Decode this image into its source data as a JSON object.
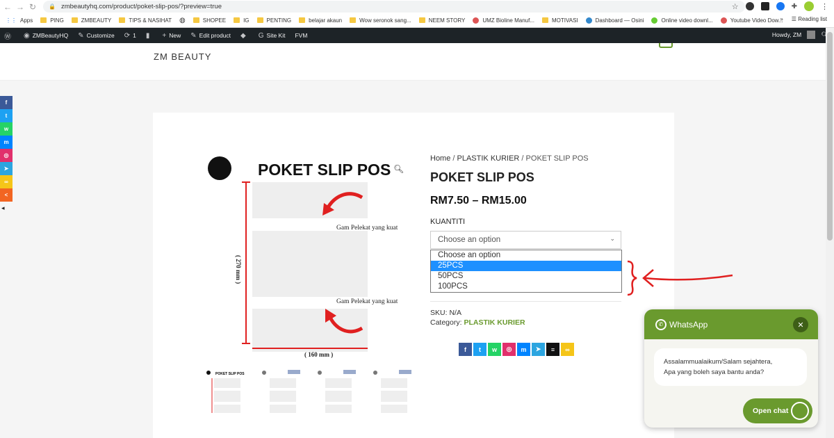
{
  "browser": {
    "url": "zmbeautyhq.com/product/poket-slip-pos/?preview=true",
    "reading_list": "Reading list"
  },
  "bookmarks": [
    {
      "label": "Apps",
      "type": "apps"
    },
    {
      "label": "PING",
      "type": "folder"
    },
    {
      "label": "ZMBEAUTY",
      "type": "folder"
    },
    {
      "label": "TIPS & NASIHAT",
      "type": "folder"
    },
    {
      "label": "",
      "type": "globe"
    },
    {
      "label": "SHOPEE",
      "type": "folder"
    },
    {
      "label": "IG",
      "type": "folder"
    },
    {
      "label": "PENTING",
      "type": "folder"
    },
    {
      "label": "belajar akaun",
      "type": "folder"
    },
    {
      "label": "Wow seronok sang...",
      "type": "folder"
    },
    {
      "label": "NEEM STORY",
      "type": "folder"
    },
    {
      "label": "UMZ Bioline Manuf...",
      "type": "site"
    },
    {
      "label": "MOTIVASI",
      "type": "folder"
    },
    {
      "label": "Dashboard — Osini",
      "type": "site"
    },
    {
      "label": "Online video downl...",
      "type": "site"
    },
    {
      "label": "Youtube Video Dow...",
      "type": "site"
    }
  ],
  "wpbar": {
    "site": "ZMBeautyHQ",
    "customize": "Customize",
    "updates": "1",
    "new": "New",
    "edit": "Edit product",
    "sitekit": "Site Kit",
    "fvm": "FVM",
    "howdy": "Howdy, ZM"
  },
  "logo": "ZM BEAUTY",
  "product": {
    "breadcrumb_home": "Home",
    "breadcrumb_sep": " / ",
    "breadcrumb_cat": "PLASTIK KURIER",
    "breadcrumb_current": "POKET SLIP POS",
    "title": "POKET SLIP POS",
    "price": "RM7.50 – RM15.00",
    "qty_label": "KUANTITI",
    "select_value": "Choose an option",
    "options": [
      "Choose an option",
      "25PCS",
      "50PCS",
      "100PCS"
    ],
    "selected_index": 1,
    "sku_label": "SKU:",
    "sku_value": "N/A",
    "category_label": "Category:",
    "category_value": "PLASTIK KURIER"
  },
  "image": {
    "title": "POKET SLIP POS",
    "glue1": "Gam Pelekat yang kuat",
    "glue2": "Gam Pelekat yang kuat",
    "height": "( 270 mm )",
    "width": "( 160 mm )"
  },
  "whatsapp": {
    "title": "WhatsApp",
    "message_line1": "Assalammualaikum/Salam sejahtera,",
    "message_line2": "Apa yang boleh saya bantu anda?",
    "button": "Open chat",
    "accent": "#6a9a2e"
  },
  "colors": {
    "accent": "#6a9a2e",
    "select_highlight": "#1e90ff",
    "annotation": "#e02020"
  }
}
